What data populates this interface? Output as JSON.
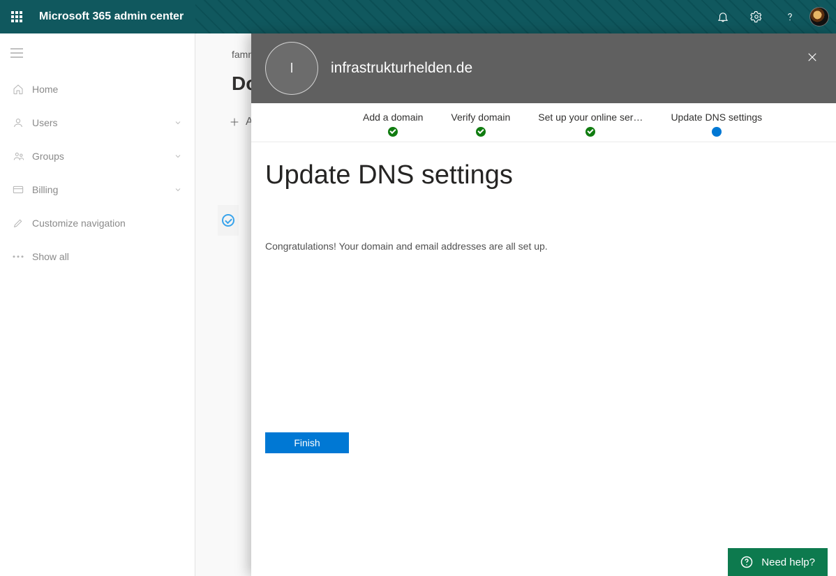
{
  "header": {
    "brand": "Microsoft 365 admin center"
  },
  "sidebar": {
    "items": [
      {
        "label": "Home",
        "expandable": false
      },
      {
        "label": "Users",
        "expandable": true
      },
      {
        "label": "Groups",
        "expandable": true
      },
      {
        "label": "Billing",
        "expandable": true
      },
      {
        "label": "Customize navigation",
        "expandable": false
      },
      {
        "label": "Show all",
        "expandable": false
      }
    ]
  },
  "main": {
    "breadcrumb_visible": "famn",
    "page_title_visible": "Do",
    "toolbar_add_visible": "A"
  },
  "panel": {
    "avatar_initial": "I",
    "domain": "infrastrukturhelden.de",
    "steps": [
      {
        "label": "Add a domain",
        "state": "done"
      },
      {
        "label": "Verify domain",
        "state": "done"
      },
      {
        "label": "Set up your online ser…",
        "state": "done"
      },
      {
        "label": "Update DNS settings",
        "state": "current"
      }
    ],
    "heading": "Update DNS settings",
    "message": "Congratulations! Your domain and email addresses are all set up.",
    "finish_label": "Finish"
  },
  "need_help": {
    "label": "Need help?"
  }
}
